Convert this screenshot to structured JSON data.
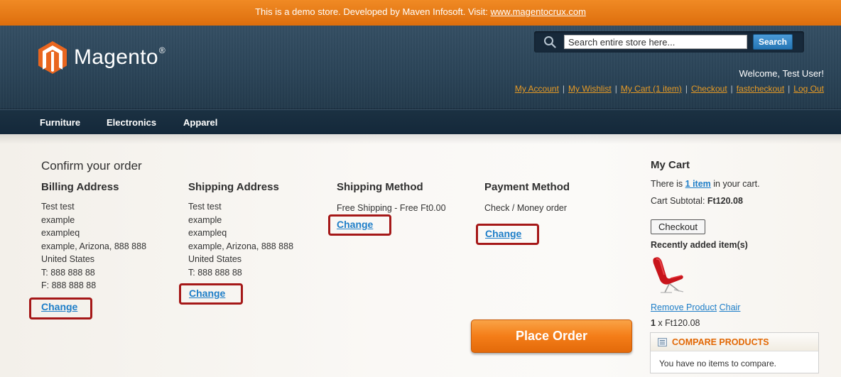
{
  "demo_notice": {
    "text": "This is a demo store. Developed by Maven Infosoft. Visit: ",
    "link": "www.magentocrux.com"
  },
  "header": {
    "logo_text": "Magento",
    "logo_reg": "®",
    "search": {
      "value": "Search entire store here...",
      "button": "Search"
    },
    "welcome": "Welcome, Test User!",
    "links": [
      "My Account",
      "My Wishlist",
      "My Cart (1 item)",
      "Checkout",
      "fastcheckout",
      "Log Out"
    ]
  },
  "nav": [
    "Furniture",
    "Electronics",
    "Apparel"
  ],
  "order": {
    "title": "Confirm your order",
    "billing": {
      "heading": "Billing Address",
      "lines": [
        "Test test",
        "example",
        "exampleq",
        "example, Arizona, 888 888",
        "United States",
        "T: 888 888 88",
        "F: 888 888 88"
      ],
      "change": "Change"
    },
    "shipping": {
      "heading": "Shipping Address",
      "lines": [
        "Test test",
        "example",
        "exampleq",
        "example, Arizona, 888 888",
        "United States",
        "T: 888 888 88"
      ],
      "change": "Change"
    },
    "shipping_method": {
      "heading": "Shipping Method",
      "text": "Free Shipping - Free Ft0.00",
      "change": "Change"
    },
    "payment_method": {
      "heading": "Payment Method",
      "text": "Check / Money order",
      "change": "Change"
    },
    "place_order": "Place Order"
  },
  "cart": {
    "title": "My Cart",
    "there_is": "There is ",
    "items_link": "1 item",
    "in_cart": " in your cart.",
    "subtotal_label": "Cart Subtotal: ",
    "subtotal_value": "Ft120.08",
    "checkout": "Checkout",
    "recent_label": "Recently added item(s)",
    "remove": "Remove Product",
    "product_name": "Chair",
    "qty": "1",
    "qty_price": " x Ft120.08"
  },
  "compare": {
    "title": "COMPARE PRODUCTS",
    "empty": "You have no items to compare."
  },
  "colors": {
    "accent_orange": "#f47d18",
    "header_navy": "#2b4458",
    "link_blue": "#1e7ec8",
    "highlight_red": "#a51818"
  }
}
